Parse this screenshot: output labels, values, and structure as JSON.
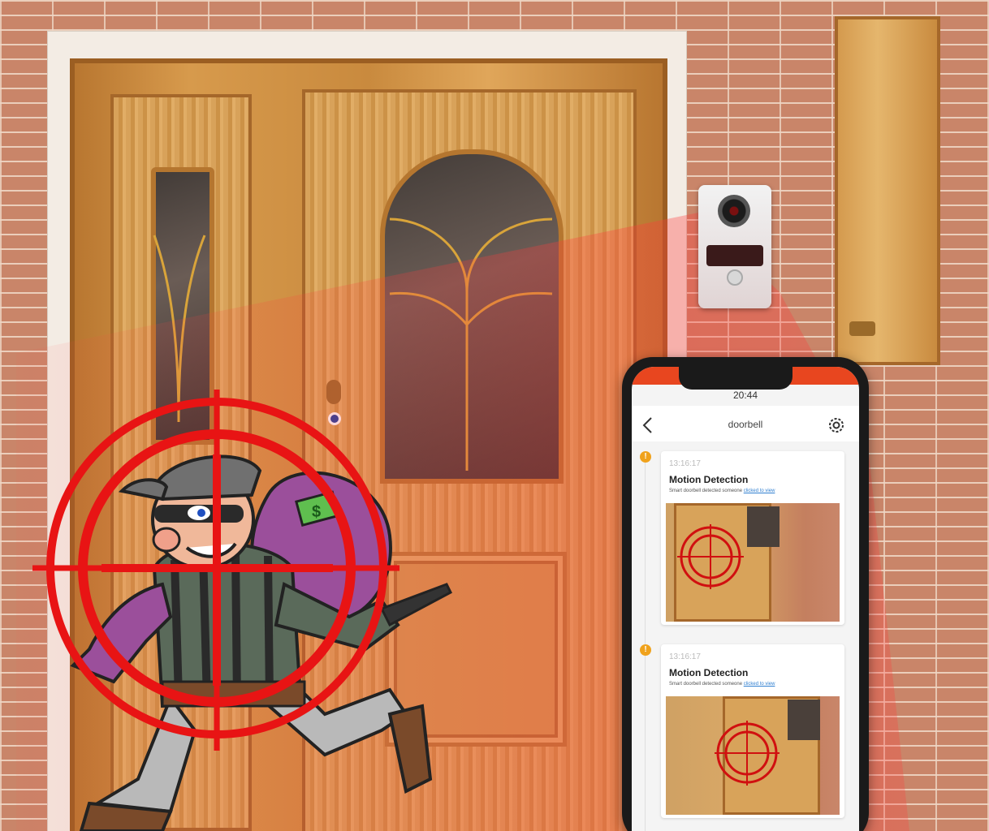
{
  "scene": {
    "subject": "thief-caught-by-doorbell",
    "colors": {
      "beam": "#ff3c3c",
      "reticle": "#e81414",
      "brick": "#c98569",
      "door": "#d39a50"
    }
  },
  "phone": {
    "time": "20:44",
    "title": "doorbell",
    "notifications": [
      {
        "time": "13:16:17",
        "title": "Motion Detection",
        "description": "Smart doorbell detected someone",
        "link": "clicked to view"
      },
      {
        "time": "13:16:17",
        "title": "Motion Detection",
        "description": "Smart doorbell detected someone",
        "link": "clicked to view"
      }
    ]
  }
}
